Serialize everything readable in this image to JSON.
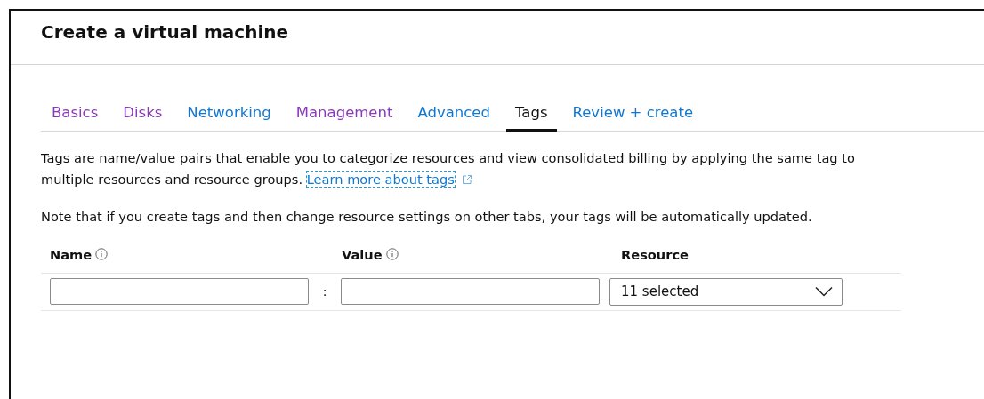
{
  "window": {
    "title": "Create a virtual machine"
  },
  "tabs": [
    {
      "label": "Basics",
      "selected": false,
      "color": "#8a3ab9"
    },
    {
      "label": "Disks",
      "selected": false,
      "color": "#8a3ab9"
    },
    {
      "label": "Networking",
      "selected": false,
      "color": "#0f78d4"
    },
    {
      "label": "Management",
      "selected": false,
      "color": "#8a3ab9"
    },
    {
      "label": "Advanced",
      "selected": false,
      "color": "#0f78d4"
    },
    {
      "label": "Tags",
      "selected": true
    },
    {
      "label": "Review + create",
      "selected": false,
      "color": "#0f78d4"
    }
  ],
  "description": {
    "text": "Tags are name/value pairs that enable you to categorize resources and view consolidated billing by applying the same tag to multiple resources and resource groups.",
    "link": "Learn more about tags"
  },
  "note": "Note that if you create tags and then change resource settings on other tabs, your tags will be automatically updated.",
  "table": {
    "columns": [
      {
        "label": "Name",
        "info": true
      },
      {
        "label": "Value",
        "info": true
      },
      {
        "label": "Resource",
        "info": false
      }
    ],
    "rows": [
      {
        "separator": ":",
        "resource": "11 selected"
      }
    ]
  }
}
